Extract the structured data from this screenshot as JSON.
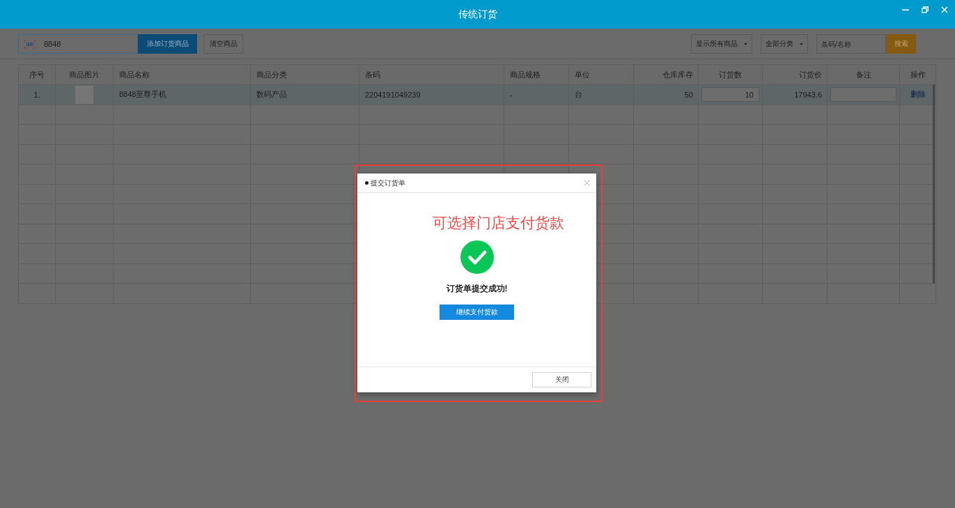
{
  "window": {
    "title": "传统订货"
  },
  "toolbar": {
    "scan_field": {
      "value": "8848"
    },
    "add_button": "添加订货商品",
    "clear_button": "清空商品",
    "filters": [
      {
        "label": "显示所有商品"
      },
      {
        "label": "全部分类"
      }
    ],
    "search_field": {
      "placeholder": "条码/名称"
    },
    "search_button": "搜索"
  },
  "table": {
    "columns": [
      "序号",
      "商品图片",
      "商品名称",
      "商品分类",
      "条码",
      "商品规格",
      "单位",
      "仓库库存",
      "订货数",
      "订货价",
      "备注",
      "操作"
    ],
    "rows": [
      {
        "selected": true,
        "cells": [
          {
            "kind": "text",
            "text": "1."
          },
          {
            "kind": "image"
          },
          {
            "kind": "text",
            "text": "8848至尊手机"
          },
          {
            "kind": "text",
            "text": "数码产品"
          },
          {
            "kind": "text",
            "text": "2204191049239"
          },
          {
            "kind": "text",
            "text": "-"
          },
          {
            "kind": "text",
            "text": "台"
          },
          {
            "kind": "text",
            "text": "50"
          },
          {
            "kind": "input",
            "value": "10"
          },
          {
            "kind": "text",
            "text": "17943.6"
          },
          {
            "kind": "input"
          },
          {
            "kind": "link",
            "text": "删除"
          }
        ]
      }
    ]
  },
  "dialog": {
    "title": "提交订货单",
    "annotation": "可选择门店支付货款",
    "message": "订货单提交成功!",
    "primary_button": "继续支付货款",
    "close_button": "关闭"
  }
}
